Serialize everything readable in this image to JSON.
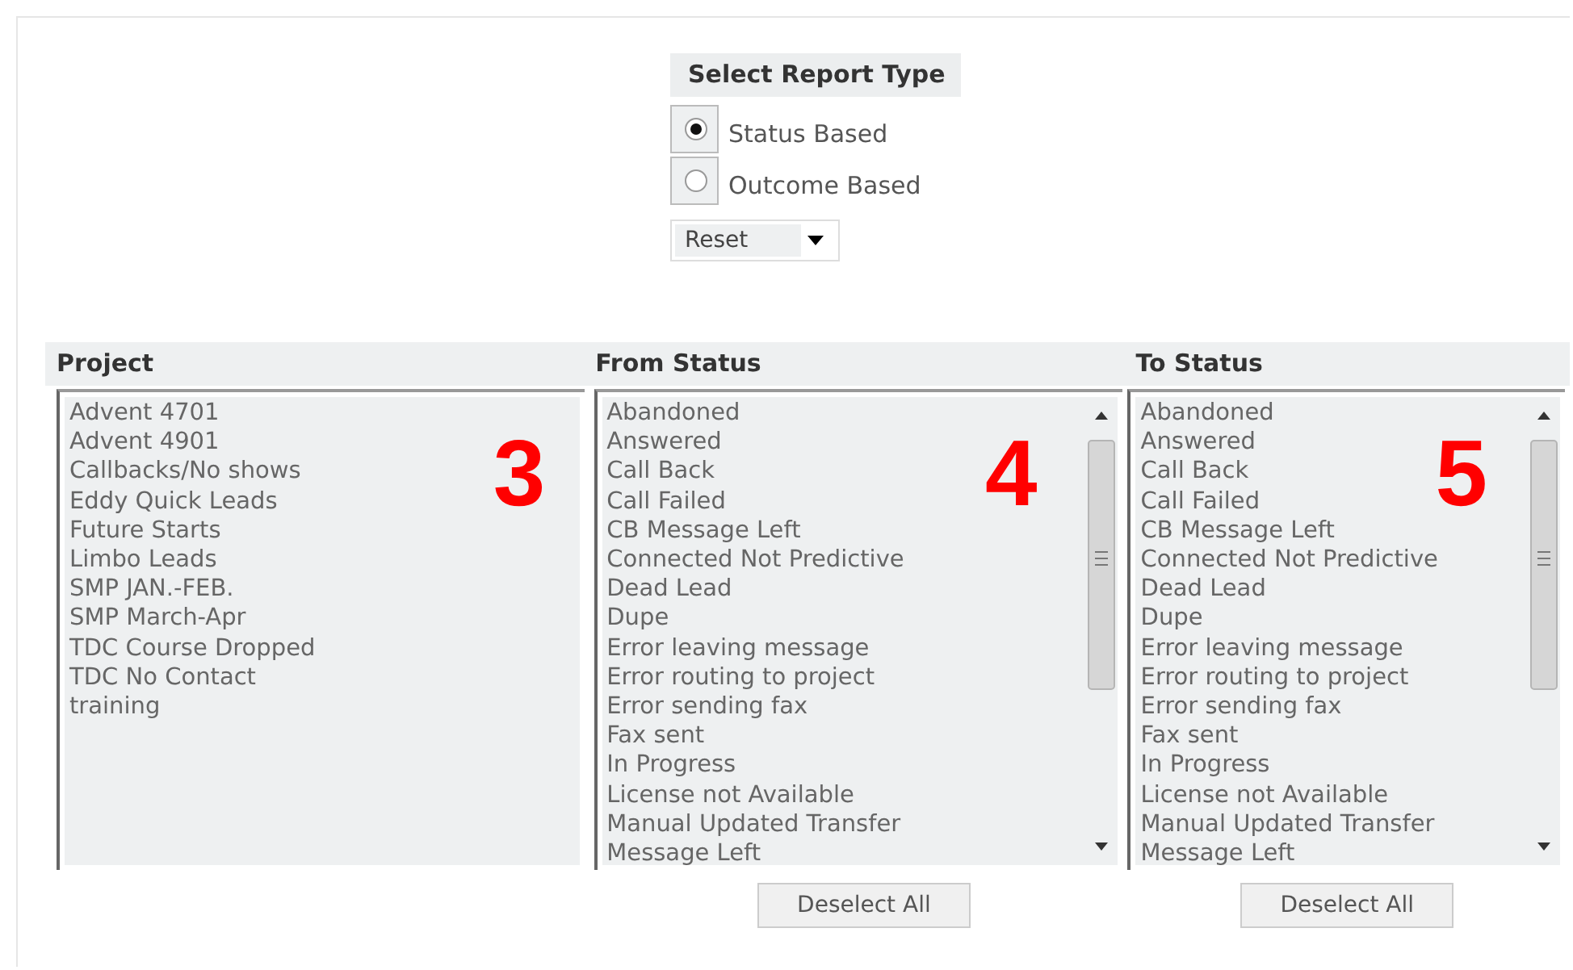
{
  "report_type": {
    "title": "Select Report Type",
    "options": [
      {
        "label": "Status Based",
        "selected": true
      },
      {
        "label": "Outcome Based",
        "selected": false
      }
    ],
    "dropdown": {
      "value": "Reset"
    }
  },
  "panels": [
    {
      "title": "Project",
      "kind": "plain",
      "callout": "3",
      "items": [
        "Advent 4701",
        "Advent 4901",
        "Callbacks/No shows",
        "Eddy Quick Leads",
        "Future Starts",
        "Limbo Leads",
        "SMP JAN.-FEB.",
        "SMP March-Apr",
        "TDC Course Dropped",
        "TDC No Contact",
        "training"
      ]
    },
    {
      "title": "From Status",
      "kind": "scrolling",
      "callout": "4",
      "button": "Deselect All",
      "items": [
        "Abandoned",
        "Answered",
        "Call Back",
        "Call Failed",
        "CB Message Left",
        "Connected Not Predictive",
        "Dead Lead",
        "Dupe",
        "Error leaving message",
        "Error routing to project",
        "Error sending fax",
        "Fax sent",
        "In Progress",
        "License not Available",
        "Manual Updated Transfer",
        "Message Left"
      ]
    },
    {
      "title": "To Status",
      "kind": "scrolling",
      "callout": "5",
      "button": "Deselect All",
      "items": [
        "Abandoned",
        "Answered",
        "Call Back",
        "Call Failed",
        "CB Message Left",
        "Connected Not Predictive",
        "Dead Lead",
        "Dupe",
        "Error leaving message",
        "Error routing to project",
        "Error sending fax",
        "Fax sent",
        "In Progress",
        "License not Available",
        "Manual Updated Transfer",
        "Message Left"
      ]
    }
  ]
}
